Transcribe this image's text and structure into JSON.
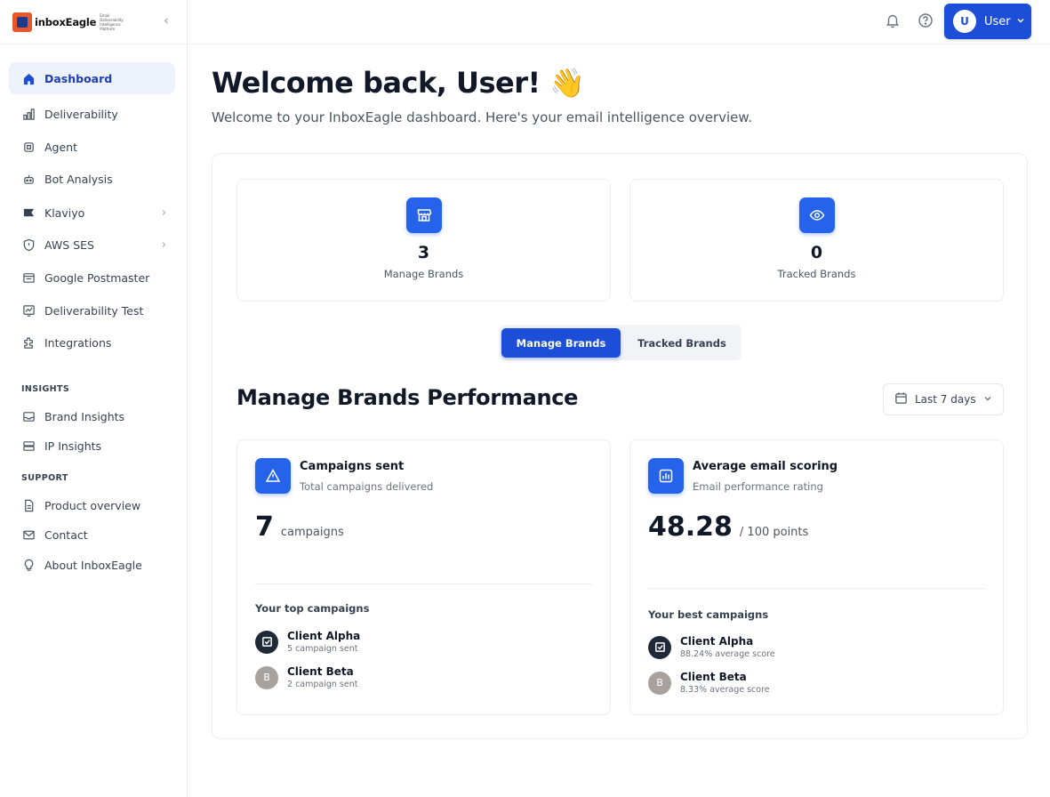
{
  "brand": {
    "logo_text": "inboxEagle",
    "logo_tagline": "Email Deliverability Intelligence Platform"
  },
  "sidebar": {
    "items": [
      {
        "label": "Dashboard",
        "icon": "home-icon",
        "active": true
      },
      {
        "label": "Deliverability",
        "icon": "bar-chart-icon"
      },
      {
        "label": "Agent",
        "icon": "chip-icon"
      },
      {
        "label": "Bot Analysis",
        "icon": "bot-icon"
      },
      {
        "label": "Klaviyo",
        "icon": "flag-icon",
        "expandable": true
      },
      {
        "label": "AWS SES",
        "icon": "shield-icon",
        "expandable": true
      },
      {
        "label": "Google Postmaster",
        "icon": "mailbox-icon"
      },
      {
        "label": "Deliverability Test",
        "icon": "test-chart-icon"
      },
      {
        "label": "Integrations",
        "icon": "puzzle-icon"
      }
    ],
    "insights_label": "INSIGHTS",
    "insights_items": [
      {
        "label": "Brand Insights",
        "icon": "inbox-icon"
      },
      {
        "label": "IP Insights",
        "icon": "server-icon"
      }
    ],
    "support_label": "SUPPORT",
    "support_items": [
      {
        "label": "Product overview",
        "icon": "document-icon"
      },
      {
        "label": "Contact",
        "icon": "mail-icon"
      },
      {
        "label": "About InboxEagle",
        "icon": "lightbulb-icon"
      }
    ]
  },
  "header": {
    "user_label": "User",
    "user_initial": "U"
  },
  "main": {
    "welcome_title": "Welcome back, User! 👋",
    "welcome_subtitle": "Welcome to your InboxEagle dashboard. Here's your email intelligence overview.",
    "stats": [
      {
        "value": "3",
        "label": "Manage Brands",
        "icon": "store-icon"
      },
      {
        "value": "0",
        "label": "Tracked Brands",
        "icon": "eye-icon"
      }
    ],
    "tabs": [
      "Manage Brands",
      "Tracked Brands"
    ],
    "active_tab": "Manage Brands",
    "performance_title": "Manage Brands Performance",
    "date_range": "Last 7 days",
    "campaigns_card": {
      "title": "Campaigns sent",
      "subtitle": "Total campaigns delivered",
      "value": "7",
      "unit": "campaigns",
      "list_title": "Your top campaigns",
      "items": [
        {
          "name": "Client Alpha",
          "meta": "5 campaign sent",
          "avatar": "check-icon"
        },
        {
          "name": "Client Beta",
          "meta": "2 campaign sent",
          "avatar": "B"
        }
      ]
    },
    "scoring_card": {
      "title": "Average email scoring",
      "subtitle": "Email performance rating",
      "value": "48.28",
      "unit": "/ 100 points",
      "list_title": "Your best campaigns",
      "items": [
        {
          "name": "Client Alpha",
          "meta": "88.24% average score",
          "avatar": "check-icon"
        },
        {
          "name": "Client Beta",
          "meta": "8.33% average score",
          "avatar": "B"
        }
      ]
    }
  },
  "colors": {
    "accent": "#1d4ed8",
    "active_nav_bg": "#eef2fb"
  }
}
